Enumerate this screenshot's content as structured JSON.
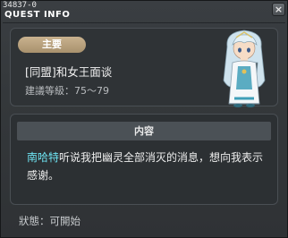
{
  "window": {
    "id_text": "34837-0",
    "title": "QUEST INFO",
    "close_label": "×"
  },
  "quest": {
    "category_badge": "主要",
    "name": "[同盟]和女王面谈",
    "recommended_level": "建議等級：75～79",
    "npc_portrait": "npc-queen-portrait"
  },
  "content": {
    "header": "内容",
    "npc_name": "南哈特",
    "description": "听说我把幽灵全部消灭的消息，想向我表示感谢。"
  },
  "status": {
    "text": "狀態：可開始"
  },
  "colors": {
    "badge": "#b8a07c",
    "npc_highlight": "#6ee3f2",
    "panel_bg": "#2f3336"
  }
}
